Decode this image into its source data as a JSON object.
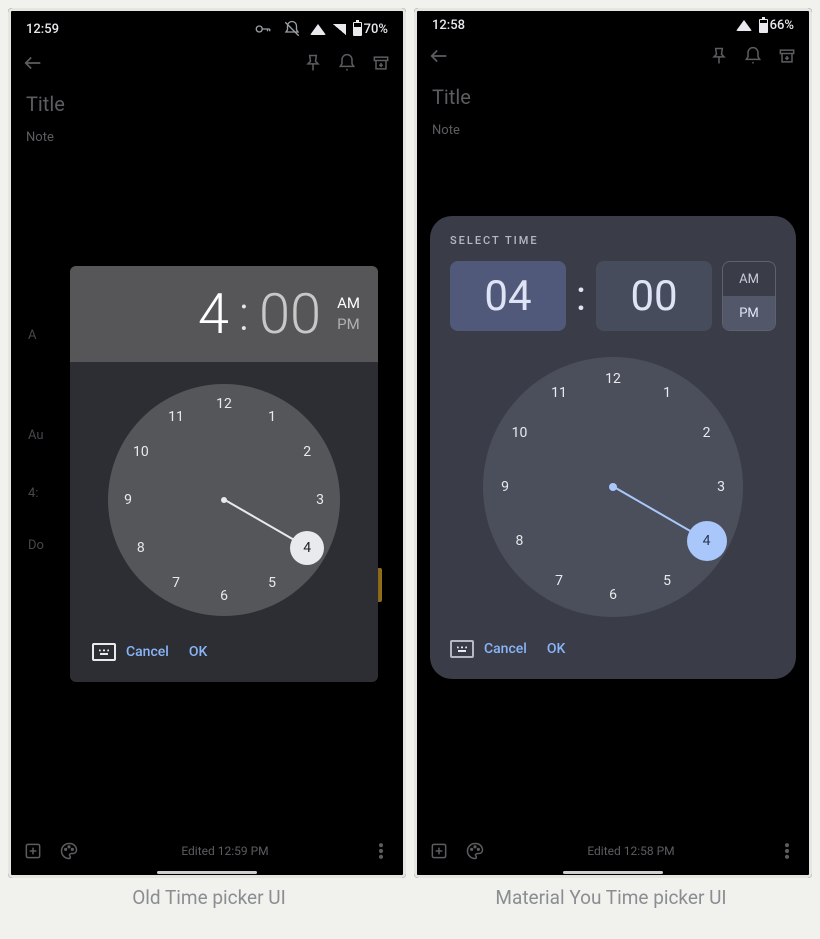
{
  "left": {
    "status": {
      "time": "12:59",
      "battery": "70%",
      "icons": [
        "vpn-key",
        "dnd-off",
        "wifi",
        "cell",
        "battery"
      ]
    },
    "keep": {
      "title_ph": "Title",
      "note_ph": "Note",
      "edited": "Edited 12:59 PM",
      "frag_a": "A",
      "frag_au": "Au",
      "frag_4": "4:",
      "frag_do": "Do"
    },
    "picker": {
      "hour": "4",
      "colon": ":",
      "minute": "00",
      "am": "AM",
      "pm": "PM",
      "numbers": [
        "12",
        "1",
        "2",
        "3",
        "4",
        "5",
        "6",
        "7",
        "8",
        "9",
        "10",
        "11"
      ],
      "selected_idx": 4,
      "cancel": "Cancel",
      "ok": "OK"
    }
  },
  "right": {
    "status": {
      "time": "12:58",
      "battery": "66%",
      "icons": [
        "wifi",
        "battery"
      ]
    },
    "keep": {
      "title_ph": "Title",
      "note_ph": "Note",
      "edited": "Edited 12:58 PM"
    },
    "picker": {
      "label": "SELECT TIME",
      "hour": "04",
      "minute": "00",
      "am": "AM",
      "pm": "PM",
      "pm_selected": true,
      "numbers": [
        "12",
        "1",
        "2",
        "3",
        "4",
        "5",
        "6",
        "7",
        "8",
        "9",
        "10",
        "11"
      ],
      "selected_idx": 4,
      "cancel": "Cancel",
      "ok": "OK"
    }
  },
  "captions": {
    "left": "Old Time picker UI",
    "right": "Material You Time picker UI"
  }
}
